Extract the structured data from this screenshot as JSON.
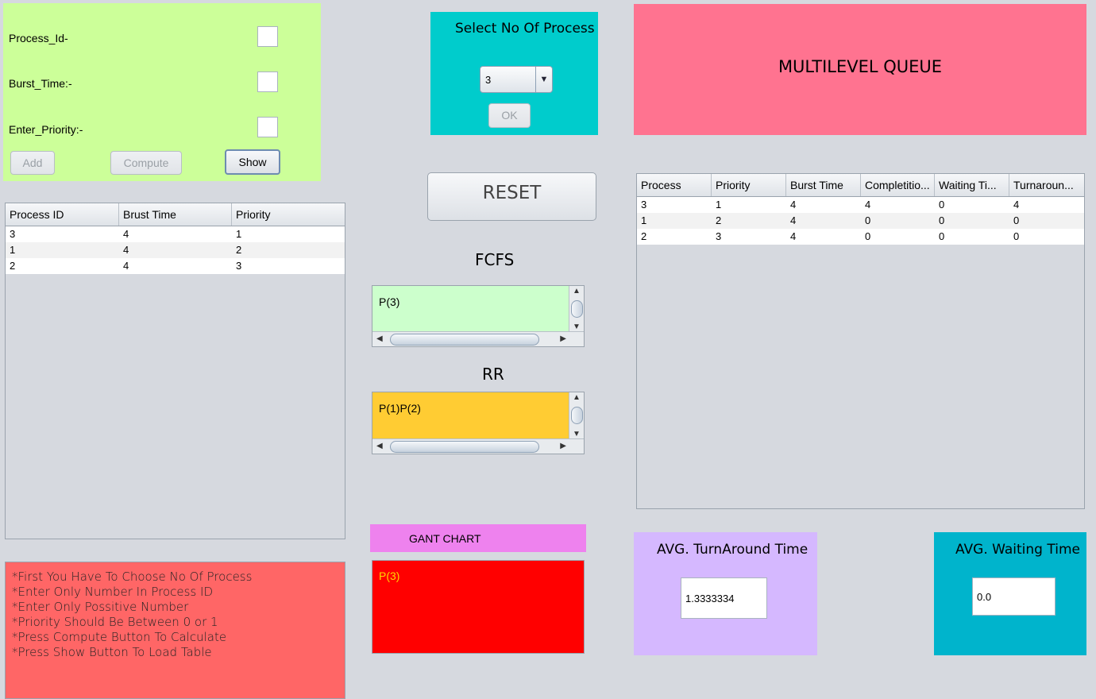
{
  "input_panel": {
    "process_id_label": "Process_Id-",
    "burst_time_label": "Burst_Time:-",
    "priority_label": "Enter_Priority:-",
    "process_id_value": "",
    "burst_time_value": "",
    "priority_value": "",
    "add_label": "Add",
    "compute_label": "Compute",
    "show_label": "Show"
  },
  "input_table": {
    "columns": [
      "Process ID",
      "Brust Time",
      "Priority"
    ],
    "rows": [
      [
        "3",
        "4",
        "1"
      ],
      [
        "1",
        "4",
        "2"
      ],
      [
        "2",
        "4",
        "3"
      ]
    ]
  },
  "select_panel": {
    "title": "Select No Of Process",
    "selected": "3",
    "ok_label": "OK"
  },
  "header": {
    "title": "MULTILEVEL QUEUE"
  },
  "reset_label": "RESET",
  "fcfs": {
    "title": "FCFS",
    "content": "P(3)"
  },
  "rr": {
    "title": "RR",
    "content": "P(1)P(2)"
  },
  "gantt": {
    "title": "GANT CHART",
    "content": "P(3)"
  },
  "result_table": {
    "columns": [
      "Process",
      "Priority",
      "Burst Time",
      "Completitio...",
      "Waiting Ti...",
      "Turnaroun..."
    ],
    "rows": [
      [
        "3",
        "1",
        "4",
        "4",
        "0",
        "4"
      ],
      [
        "1",
        "2",
        "4",
        "0",
        "0",
        "0"
      ],
      [
        "2",
        "3",
        "4",
        "0",
        "0",
        "0"
      ]
    ]
  },
  "avg_turnaround": {
    "label": "AVG. TurnAround Time",
    "value": "1.3333334"
  },
  "avg_waiting": {
    "label": "AVG. Waiting Time",
    "value": "0.0"
  },
  "notes": [
    "*First You Have To Choose No Of Process",
    "*Enter Only Number In Process ID",
    "*Enter Only Possitive Number",
    "*Priority Should Be Between 0 or 1",
    "*Press Compute Button To Calculate",
    "*Press Show Button To Load Table"
  ],
  "colors": {
    "input_panel": "#ccff99",
    "select_panel": "#00cccc",
    "header_panel": "#ff7390",
    "fcfs_area": "#ccffcc",
    "rr_area": "#ffcc33",
    "gantt_title": "#ee82ee",
    "gantt_area": "#ff0000",
    "avg_turnaround_panel": "#d5b8ff",
    "avg_waiting_panel": "#00b4cc",
    "notes_panel": "#ff6666"
  }
}
